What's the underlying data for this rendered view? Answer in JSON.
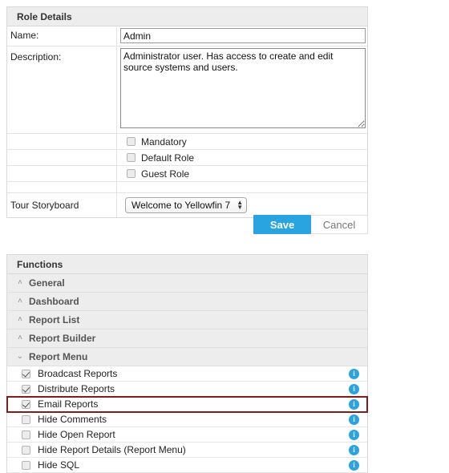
{
  "role_details": {
    "header": "Role Details",
    "name_label": "Name:",
    "name_value": "Admin",
    "name_placeholder": "",
    "description_label": "Description:",
    "description_value": "Administrator user. Has access to create and edit source systems and users.",
    "description_placeholder": "",
    "options": [
      {
        "label": "Mandatory",
        "checked": false
      },
      {
        "label": "Default Role",
        "checked": false
      },
      {
        "label": "Guest Role",
        "checked": false
      }
    ],
    "tour_label": "Tour Storyboard",
    "tour_value": "Welcome to Yellowfin 7"
  },
  "actions": {
    "save_label": "Save",
    "cancel_label": "Cancel"
  },
  "functions": {
    "header": "Functions",
    "groups": [
      {
        "label": "General",
        "expanded": false,
        "chevron": "chevron-up-icon"
      },
      {
        "label": "Dashboard",
        "expanded": false,
        "chevron": "chevron-up-icon"
      },
      {
        "label": "Report List",
        "expanded": false,
        "chevron": "chevron-up-icon"
      },
      {
        "label": "Report Builder",
        "expanded": false,
        "chevron": "chevron-up-icon"
      },
      {
        "label": "Report Menu",
        "expanded": true,
        "chevron": "chevron-down-icon"
      }
    ],
    "items": [
      {
        "label": "Broadcast Reports",
        "checked": true,
        "highlighted": false
      },
      {
        "label": "Distribute Reports",
        "checked": true,
        "highlighted": false
      },
      {
        "label": "Email Reports",
        "checked": true,
        "highlighted": true
      },
      {
        "label": "Hide Comments",
        "checked": false,
        "highlighted": false
      },
      {
        "label": "Hide Open Report",
        "checked": false,
        "highlighted": false
      },
      {
        "label": "Hide Report Details (Report Menu)",
        "checked": false,
        "highlighted": false
      },
      {
        "label": "Hide SQL",
        "checked": false,
        "highlighted": false
      }
    ],
    "info_icon_glyph": "i"
  },
  "colors": {
    "accent_blue": "#29a4e0",
    "highlight_red": "#7d1f1f",
    "header_gray": "#ededed"
  }
}
